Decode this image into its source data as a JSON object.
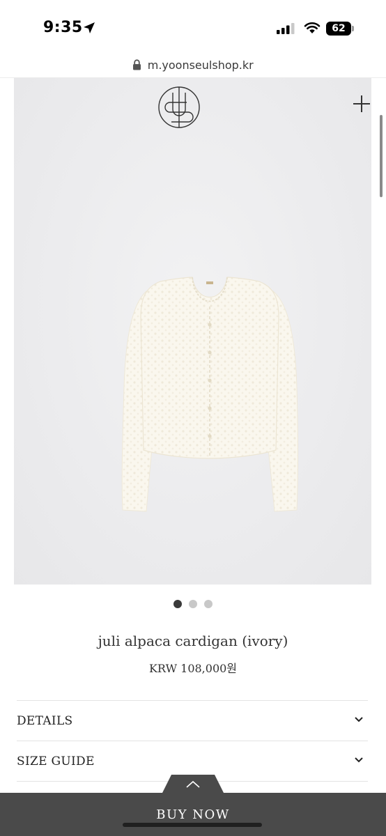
{
  "status_bar": {
    "time": "9:35",
    "battery": "62",
    "icons": [
      "location-arrow-icon",
      "cellular-signal-icon",
      "wifi-icon",
      "battery-icon"
    ]
  },
  "browser": {
    "url": "m.yoonseulshop.kr",
    "icon": "lock-icon"
  },
  "header": {
    "logo_icon": "brand-monogram-logo",
    "menu_icon": "plus-icon"
  },
  "gallery": {
    "image": "ivory alpaca cardigan",
    "slide_count": 3,
    "active_slide": 1
  },
  "product": {
    "title": "juli alpaca cardigan (ivory)",
    "price": "KRW 108,000원"
  },
  "accordions": [
    {
      "label": "DETAILS",
      "icon": "chevron-down-icon"
    },
    {
      "label": "SIZE GUIDE",
      "icon": "chevron-down-icon"
    }
  ],
  "buy": {
    "label": "BUY NOW",
    "toggle_icon": "chevron-up-icon"
  },
  "colors": {
    "image_background": "#ebebed",
    "buy_bar": "#4a4a4a",
    "dot_active": "#3a3a3a",
    "dot_inactive": "#c8c8c8"
  }
}
